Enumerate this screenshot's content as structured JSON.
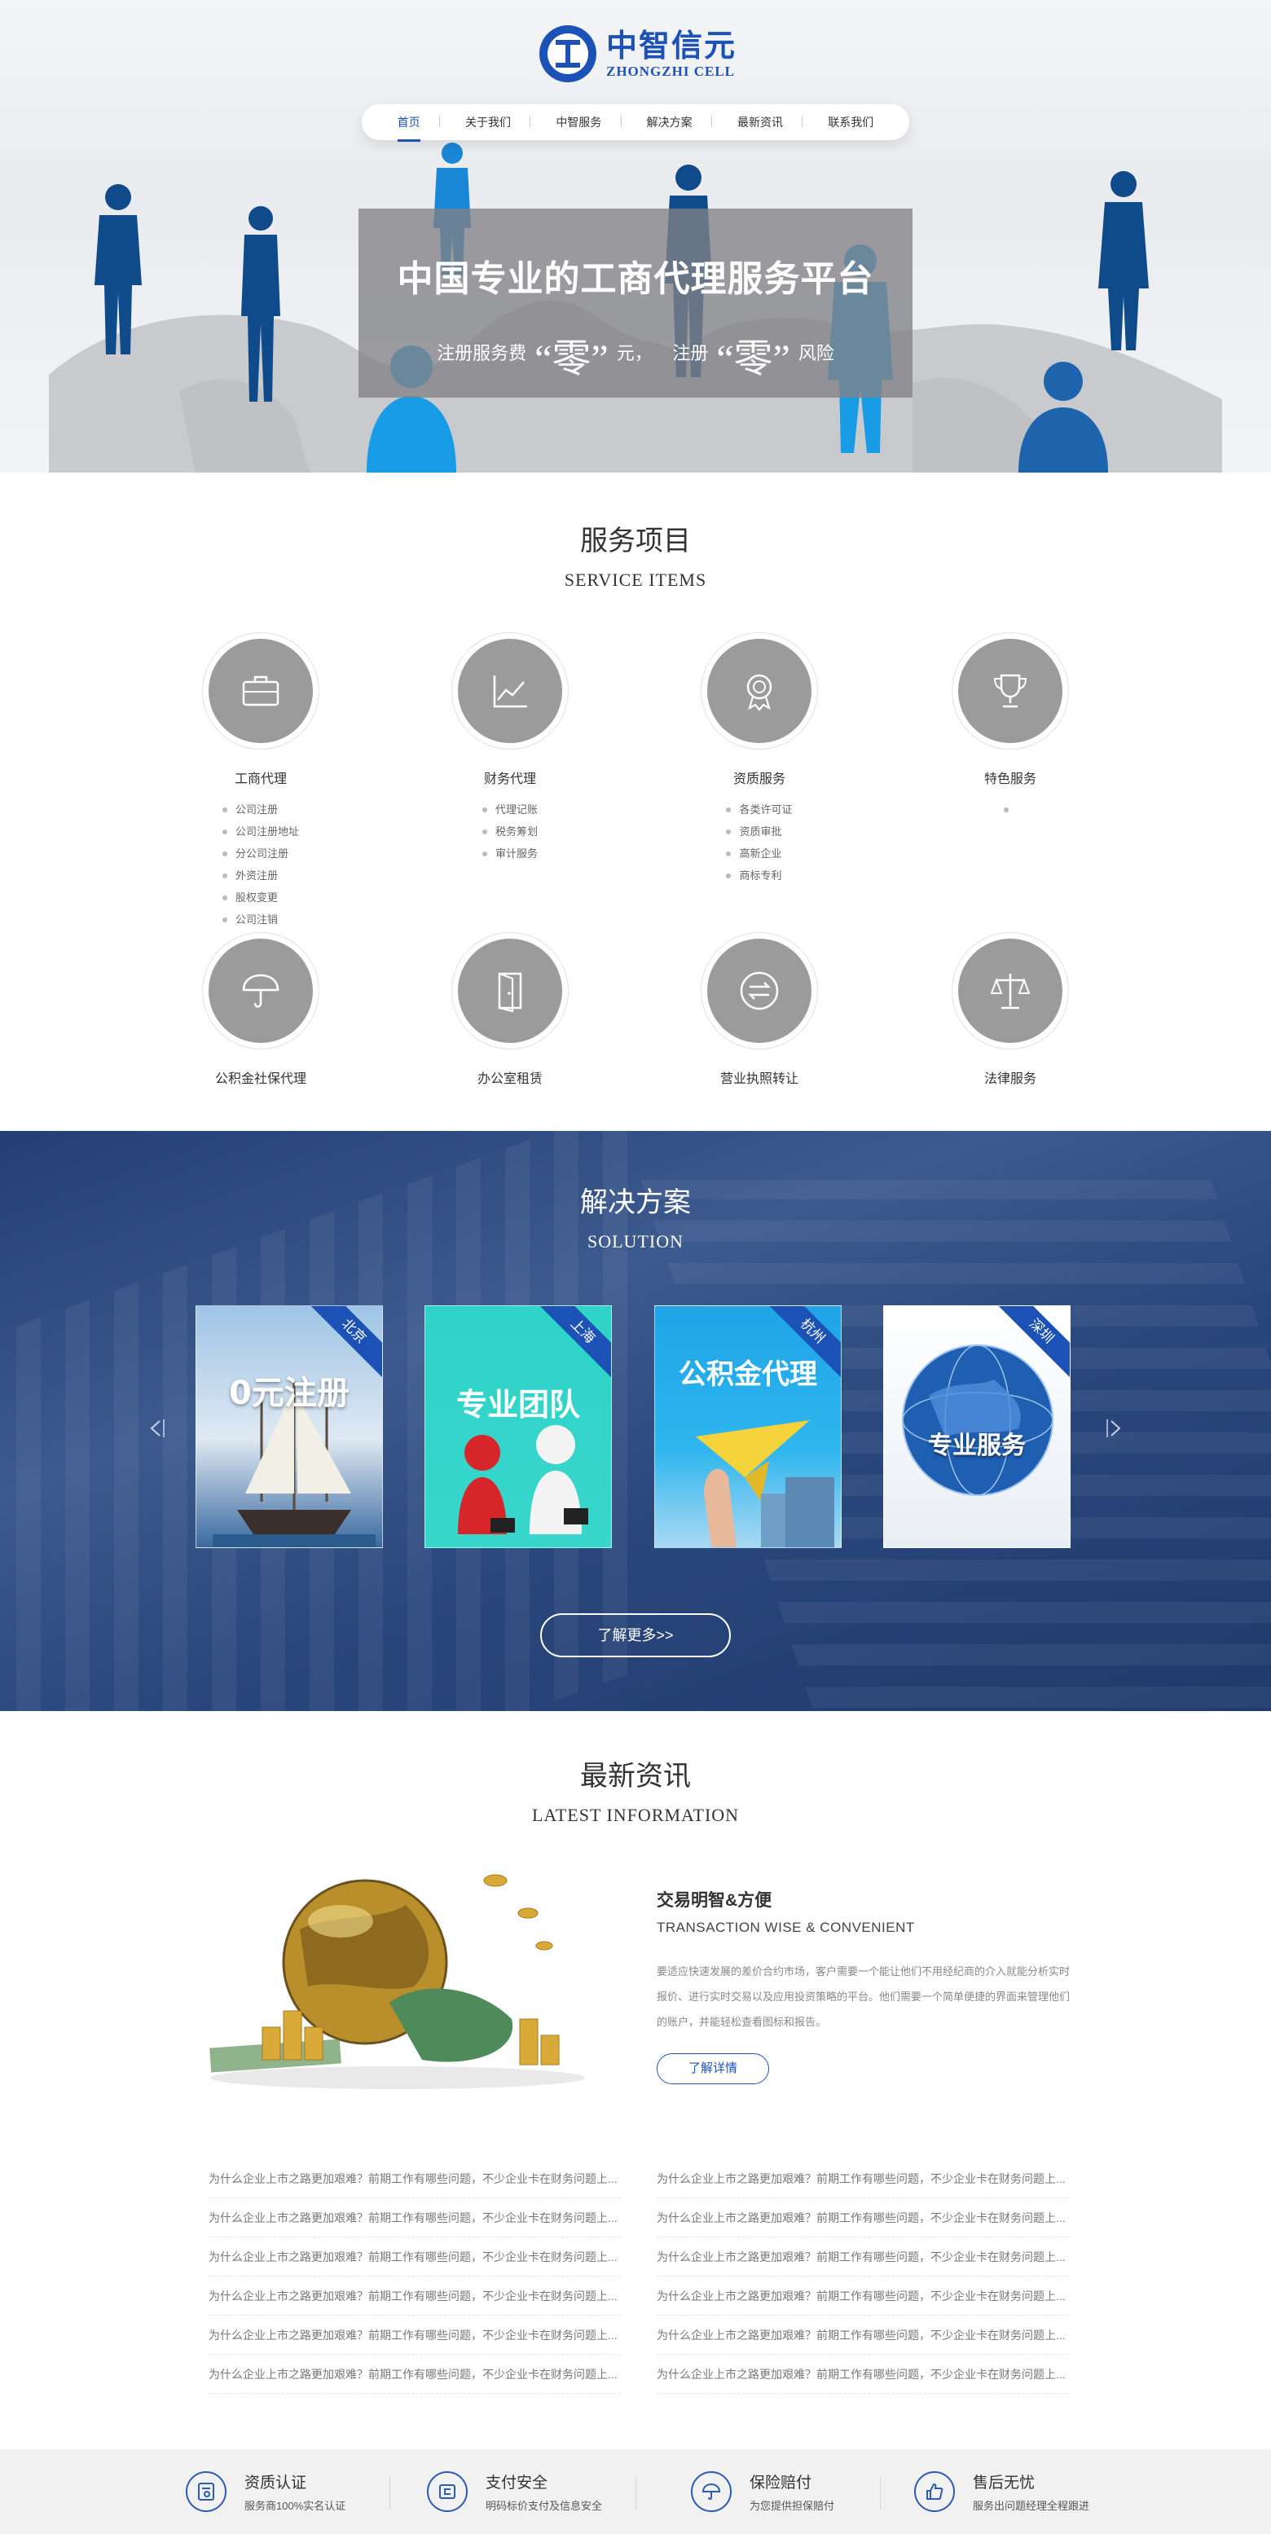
{
  "header": {
    "logo_cn": "中智信元",
    "logo_en": "ZHONGZHI CELL",
    "nav": [
      "首页",
      "关于我们",
      "中智服务",
      "解决方案",
      "最新资讯",
      "联系我们"
    ]
  },
  "banner": {
    "title": "中国专业的工商代理服务平台",
    "sub_1": "注册服务费",
    "sub_zero_1": "“零”",
    "sub_2": "元，",
    "sub_3": "注册",
    "sub_zero_2": "“零”",
    "sub_4": "风险"
  },
  "services": {
    "title_cn": "服务项目",
    "title_en": "SERVICE ITEMS",
    "items": [
      {
        "name": "工商代理",
        "icon": "briefcase-icon",
        "sub": [
          "公司注册",
          "公司注册地址",
          "分公司注册",
          "外资注册",
          "股权变更",
          "公司注销"
        ]
      },
      {
        "name": "财务代理",
        "icon": "chart-icon",
        "sub": [
          "代理记账",
          "税务筹划",
          "审计服务"
        ]
      },
      {
        "name": "资质服务",
        "icon": "medal-icon",
        "sub": [
          "各类许可证",
          "资质审批",
          "高新企业",
          "商标专利"
        ]
      },
      {
        "name": "特色服务",
        "icon": "trophy-icon",
        "sub": []
      },
      {
        "name": "公积金社保代理",
        "icon": "umbrella-icon",
        "sub": []
      },
      {
        "name": "办公室租赁",
        "icon": "door-icon",
        "sub": []
      },
      {
        "name": "营业执照转让",
        "icon": "transfer-icon",
        "sub": []
      },
      {
        "name": "法律服务",
        "icon": "scale-icon",
        "sub": []
      }
    ]
  },
  "solution": {
    "title_cn": "解决方案",
    "title_en": "SOLUTION",
    "cards": [
      {
        "city": "北京",
        "caption": "0元注册"
      },
      {
        "city": "上海",
        "caption": "专业团队"
      },
      {
        "city": "杭州",
        "caption": "公积金代理"
      },
      {
        "city": "深圳",
        "caption": "专业服务"
      }
    ],
    "more_label": "了解更多>>"
  },
  "news": {
    "title_cn": "最新资讯",
    "title_en": "LATEST INFORMATION",
    "featured_title": "交易明智&方便",
    "featured_en": "TRANSACTION WISE & CONVENIENT",
    "featured_desc": "要适应快速发展的差价合约市场，客户需要一个能让他们不用经纪商的介入就能分析实时报价、进行实时交易以及应用投资策略的平台。他们需要一个简单便捷的界面来管理他们的账户，并能轻松查看图标和报告。",
    "detail_label": "了解详情",
    "list_left": [
      "为什么企业上市之路更加艰难？前期工作有哪些问题，不少企业卡在财务问题上...",
      "为什么企业上市之路更加艰难？前期工作有哪些问题，不少企业卡在财务问题上...",
      "为什么企业上市之路更加艰难？前期工作有哪些问题，不少企业卡在财务问题上...",
      "为什么企业上市之路更加艰难？前期工作有哪些问题，不少企业卡在财务问题上...",
      "为什么企业上市之路更加艰难？前期工作有哪些问题，不少企业卡在财务问题上...",
      "为什么企业上市之路更加艰难？前期工作有哪些问题，不少企业卡在财务问题上..."
    ],
    "list_right": [
      "为什么企业上市之路更加艰难？前期工作有哪些问题，不少企业卡在财务问题上...",
      "为什么企业上市之路更加艰难？前期工作有哪些问题，不少企业卡在财务问题上...",
      "为什么企业上市之路更加艰难？前期工作有哪些问题，不少企业卡在财务问题上...",
      "为什么企业上市之路更加艰难？前期工作有哪些问题，不少企业卡在财务问题上...",
      "为什么企业上市之路更加艰难？前期工作有哪些问题，不少企业卡在财务问题上...",
      "为什么企业上市之路更加艰难？前期工作有哪些问题，不少企业卡在财务问题上..."
    ]
  },
  "footer": {
    "items": [
      {
        "title": "资质认证",
        "sub": "服务商100%实名认证",
        "icon": "certificate-icon"
      },
      {
        "title": "支付安全",
        "sub": "明码标价支付及信息安全",
        "icon": "payment-icon"
      },
      {
        "title": "保险赔付",
        "sub": "为您提供担保赔付",
        "icon": "umbrella-icon"
      },
      {
        "title": "售后无忧",
        "sub": "服务出问题经理全程跟进",
        "icon": "thumbs-up-icon"
      }
    ]
  },
  "colors": {
    "brand": "#1c52b5",
    "circle_gray": "#9b9b9b",
    "solution_bg": "#2a477c"
  }
}
